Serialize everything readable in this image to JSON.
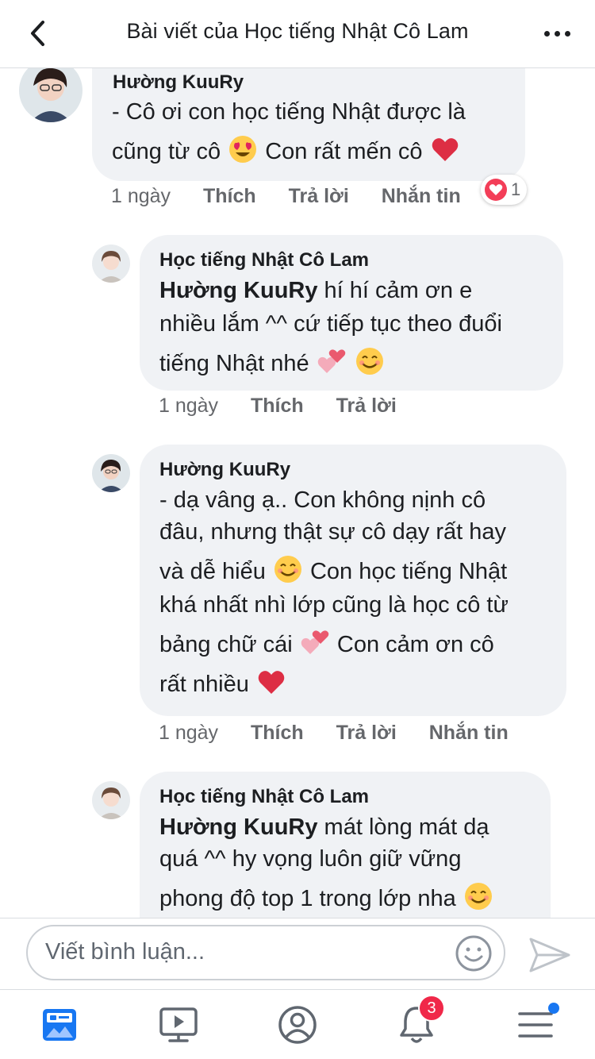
{
  "header": {
    "title": "Bài viết của Học tiếng Nhật Cô Lam"
  },
  "comments": [
    {
      "author": "Hường KuuRy",
      "lines": [
        "- Cô ơi con học tiếng Nhật được là",
        "cũng từ cô",
        "Con rất mến cô"
      ],
      "time": "1 ngày",
      "like": "Thích",
      "reply": "Trả lời",
      "message": "Nhắn tin",
      "reaction_count": "1"
    },
    {
      "author": "Học tiếng Nhật Cô Lam",
      "mention": "Hường KuuRy",
      "lines": [
        " hí hí cảm ơn e",
        "nhiều lắm ^^ cứ tiếp tục theo đuổi",
        "tiếng Nhật nhé"
      ],
      "time": "1 ngày",
      "like": "Thích",
      "reply": "Trả lời"
    },
    {
      "author": "Hường KuuRy",
      "lines": [
        "- dạ vâng ạ.. Con không nịnh cô",
        "đâu, nhưng thật sự cô dạy rất hay",
        "và dễ hiểu",
        "Con học tiếng Nhật",
        "khá nhất nhì lớp cũng là học cô từ",
        "bảng chữ cái",
        "Con cảm ơn cô",
        "rất nhiều"
      ],
      "time": "1 ngày",
      "like": "Thích",
      "reply": "Trả lời",
      "message": "Nhắn tin"
    },
    {
      "author": "Học tiếng Nhật Cô Lam",
      "mention": "Hường KuuRy",
      "lines": [
        " mát lòng mát dạ",
        "quá ^^ hy vọng luôn giữ vững",
        "phong độ top 1 trong lớp nha"
      ]
    }
  ],
  "composer": {
    "placeholder": "Viết bình luận..."
  },
  "tabbar": {
    "notifications_badge": "3"
  },
  "colors": {
    "accent": "#1877f2",
    "badge": "#f02849",
    "bubble": "#f0f2f5",
    "meta_text": "#65676b"
  },
  "icons": [
    "back-arrow-icon",
    "more-dots-icon",
    "heart-eyes-emoji-icon",
    "red-heart-emoji-icon",
    "two-hearts-emoji-icon",
    "smiling-face-emoji-icon",
    "smiley-icon",
    "send-icon",
    "news-feed-icon",
    "watch-icon",
    "profile-icon",
    "bell-icon",
    "menu-icon"
  ]
}
